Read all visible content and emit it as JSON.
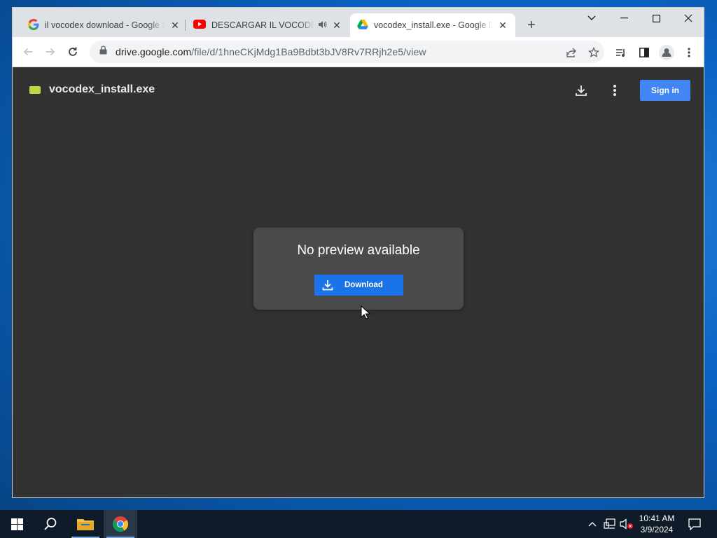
{
  "browser": {
    "tabs": [
      {
        "title": "il vocodex download - Google Se",
        "favicon": "google-g-icon",
        "active": false
      },
      {
        "title": "DESCARGAR IL VOCODEX PA",
        "favicon": "youtube-icon",
        "active": false,
        "audio": true
      },
      {
        "title": "vocodex_install.exe - Google Dri",
        "favicon": "google-drive-icon",
        "active": true
      }
    ],
    "new_tab_label": "+",
    "url_host": "drive.google.com",
    "url_path": "/file/d/1hneCKjMdg1Ba9Bdbt3bJV8Rv7RRjh2e5/view"
  },
  "drive": {
    "file_name": "vocodex_install.exe",
    "sign_in_label": "Sign in",
    "no_preview_text": "No preview available",
    "download_label": "Download"
  },
  "taskbar": {
    "time": "10:41 AM",
    "date": "3/9/2024"
  },
  "colors": {
    "accent_blue": "#1a73e8",
    "signin_blue": "#4285f4",
    "viewer_bg": "#323232",
    "card_bg": "#4a4a4a",
    "file_icon_green": "#c0d742"
  }
}
